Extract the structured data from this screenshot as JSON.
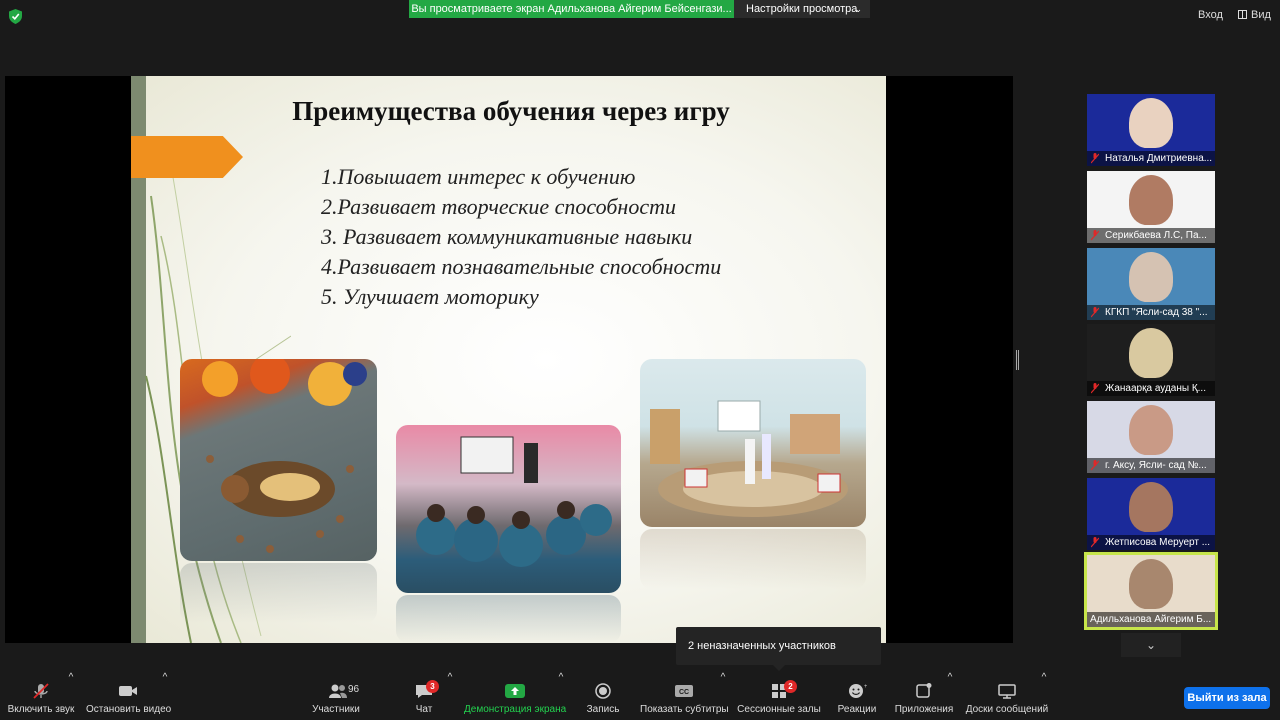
{
  "topbar": {
    "viewing_notice": "Вы просматриваете экран Адильханова Айгерим Бейсенгази...",
    "view_settings": "Настройки просмотра",
    "enter": "Вход",
    "view": "Вид",
    "shield_color": "#23a844"
  },
  "slide": {
    "title": "Преимущества обучения через игру",
    "items": [
      "1.Повышает интерес к обучению",
      "2.Развивает творческие способности",
      "3. Развивает коммуникативные навыки",
      "4.Развивает познавательные способности",
      "5. Улучшает моторику"
    ],
    "accent_color": "#f0901e"
  },
  "participants": [
    {
      "name": "Наталья Дмитриевна...",
      "muted": true,
      "bg": "#1b2a9a",
      "face": "#e9d2c0"
    },
    {
      "name": "Серикбаева Л.С, Па...",
      "muted": true,
      "bg": "#f4f4f4",
      "face": "#b07b63"
    },
    {
      "name": "КГКП \"Ясли-сад 38 \"...",
      "muted": true,
      "bg": "#4a88b8",
      "face": "#d5c2b2"
    },
    {
      "name": "Жанаарқа ауданы Қ...",
      "muted": true,
      "bg": "#1e1e1e",
      "face": "#d9c9a0"
    },
    {
      "name": "г. Аксу, Ясли- сад №...",
      "muted": true,
      "bg": "#d7d9e6",
      "face": "#c99a86"
    },
    {
      "name": "Жетписова Меруерт ...",
      "muted": true,
      "bg": "#1b2a9a",
      "face": "#a57660"
    },
    {
      "name": "Адильханова Айгерим Б...",
      "muted": false,
      "bg": "#e8dccb",
      "face": "#a8876e",
      "active": true
    }
  ],
  "tooltip": "2 неназначенных участников",
  "toolbar": {
    "mute": "Включить звук",
    "video": "Остановить видео",
    "participants": "Участники",
    "participants_count": "96",
    "chat": "Чат",
    "chat_badge": "3",
    "share": "Демонстрация экрана",
    "record": "Запись",
    "captions": "Показать субтитры",
    "breakout": "Сессионные залы",
    "breakout_badge": "2",
    "reactions": "Реакции",
    "apps": "Приложения",
    "whiteboards": "Доски сообщений",
    "leave": "Выйти из зала"
  }
}
